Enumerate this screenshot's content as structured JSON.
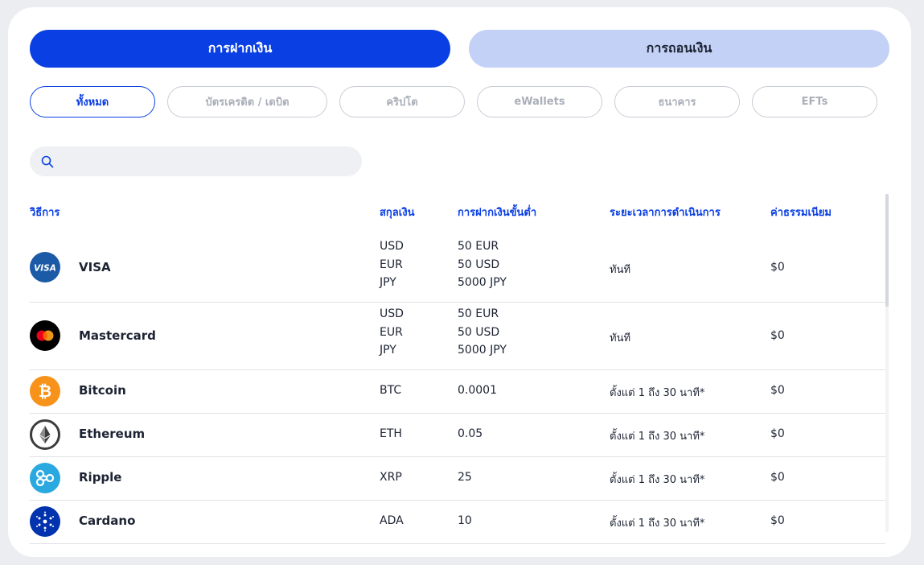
{
  "tabs": {
    "deposit": "การฝากเงิน",
    "withdraw": "การถอนเงิน"
  },
  "filters": [
    "ทั้งหมด",
    "บัตรเครดิต / เดบิต",
    "คริปโต",
    "eWallets",
    "ธนาคาร",
    "EFTs"
  ],
  "search": {
    "placeholder": "",
    "icon": "search-icon"
  },
  "table": {
    "headers": {
      "method": "วิธีการ",
      "currency": "สกุลเงิน",
      "min_deposit": "การฝากเงินขั้นต่ำ",
      "processing_time": "ระยะเวลาการดำเนินการ",
      "fee": "ค่าธรรมเนียม"
    },
    "rows": [
      {
        "name": "VISA",
        "logo": "visa-icon",
        "currencies": [
          "USD",
          "EUR",
          "JPY"
        ],
        "minimums": [
          "50 EUR",
          "50 USD",
          "5000 JPY"
        ],
        "time": "ทันที",
        "fee": "$0"
      },
      {
        "name": "Mastercard",
        "logo": "mastercard-icon",
        "currencies": [
          "USD",
          "EUR",
          "JPY"
        ],
        "minimums": [
          "50 EUR",
          "50 USD",
          "5000 JPY"
        ],
        "time": "ทันที",
        "fee": "$0"
      },
      {
        "name": "Bitcoin",
        "logo": "bitcoin-icon",
        "currency": "BTC",
        "minimum": "0.0001",
        "time": "ตั้งแต่ 1 ถึง 30 นาที*",
        "fee": "$0"
      },
      {
        "name": "Ethereum",
        "logo": "ethereum-icon",
        "currency": "ETH",
        "minimum": "0.05",
        "time": "ตั้งแต่ 1 ถึง 30 นาที*",
        "fee": "$0"
      },
      {
        "name": "Ripple",
        "logo": "ripple-icon",
        "currency": "XRP",
        "minimum": "25",
        "time": "ตั้งแต่ 1 ถึง 30 นาที*",
        "fee": "$0"
      },
      {
        "name": "Cardano",
        "logo": "cardano-icon",
        "currency": "ADA",
        "minimum": "10",
        "time": "ตั้งแต่ 1 ถึง 30 นาที*",
        "fee": "$0"
      }
    ]
  },
  "colors": {
    "accent": "#0a3fe4",
    "tab_inactive": "#c3d1f6",
    "bitcoin": "#f7931a",
    "ripple": "#29a9e0",
    "cardano": "#0033ad",
    "visa": "#1a5aa6"
  }
}
